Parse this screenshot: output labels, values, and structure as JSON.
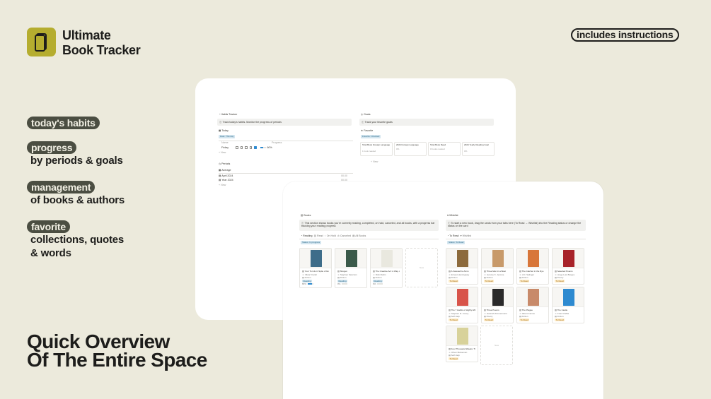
{
  "brand": {
    "title_line1": "Ultimate",
    "title_line2": "Book Tracker",
    "instructions_badge": "includes instructions"
  },
  "features": [
    {
      "pill": "today's habits",
      "sub1": "",
      "sub2": ""
    },
    {
      "pill": "progress",
      "sub1": "by periods & goals",
      "sub2": ""
    },
    {
      "pill": "management",
      "sub1": "of books & authors",
      "sub2": ""
    },
    {
      "pill": "favorite",
      "sub1": "collections, quotes",
      "sub2": "& words"
    }
  ],
  "headline": {
    "line1": "Quick Overview",
    "line2": "Of The Entire Space"
  },
  "back_screen": {
    "habits": {
      "title": "Habits Tracker",
      "callout": "Track today's habits. Monitor the progress of periods",
      "today_label": "Today",
      "today_chip": "Date: This day",
      "col_name": "Name",
      "col_progress": "Progress",
      "row_name": "Friday",
      "row_progress": "60%",
      "new": "New"
    },
    "periods": {
      "title": "Periods",
      "view": "Average",
      "rows": [
        {
          "name": "April 2024",
          "value": "00.00"
        },
        {
          "name": "Year 2024",
          "value": "00.00"
        }
      ],
      "new": "New"
    },
    "goals": {
      "title": "Goals",
      "callout": "Track your favorite goals",
      "fav_label": "Favorite",
      "fav_chip": "Favorite: Checked",
      "cards": [
        {
          "title": "Total Book Foreign Language",
          "sub": "1 book readed"
        },
        {
          "title": "2024 Foreign Language",
          "sub": "0%"
        },
        {
          "title": "Total Book Read",
          "sub": "0 books readed"
        },
        {
          "title": "2024 Yearly Reading Goal",
          "sub": "0%"
        }
      ],
      "new": "New"
    }
  },
  "front_screen": {
    "books": {
      "title": "Books",
      "callout": "This section shows books you're currently reading, completed, on hold, canceled, and all books, with a progress bar tracking your reading progress",
      "tabs": [
        "Reading",
        "Read",
        "On Hold",
        "Canceled",
        "All Books"
      ],
      "filter": "Status: In progress",
      "new": "New",
      "cards": [
        {
          "title": "Your To Life in Spite of Everything",
          "author": "Viktor Frankl",
          "type": "Fiction",
          "status": "Reading",
          "progress": "80%",
          "fill": 0.8,
          "cover": "#3e6d8a"
        },
        {
          "title": "Shogun",
          "author": "Stephen Sanctum",
          "type": "Fiction",
          "status": "Reading",
          "progress": "0%",
          "fill": 0.0,
          "cover": "#3b5a4a"
        },
        {
          "title": "The Creative Act: A Way of Bein",
          "author": "Rick Rubin",
          "type": "Fiction",
          "status": "Reading",
          "progress": "0%",
          "fill": 0.0,
          "cover": "#e9e8df"
        }
      ]
    },
    "wishlist": {
      "title": "Wishlist",
      "callout": "To start a new book, drag the cards from your tabs here (To Read → Wishlist) into the Reading status or change the status on the card",
      "tabs": [
        "To Read",
        "Wishlist"
      ],
      "filter": "Status: To Read",
      "new": "New",
      "cards": [
        {
          "title": "A Farewell to Arms",
          "author": "Ernest Hemingway",
          "type": "Fiction",
          "status": "To Read",
          "cover": "#8c6a3c"
        },
        {
          "title": "Three Men in a Boat",
          "author": "Jerome K. Jerome",
          "type": "Fiction",
          "status": "To Read",
          "cover": "#c89a6a"
        },
        {
          "title": "The Catcher in the Rye",
          "author": "J.D. Salinger",
          "type": "Fiction",
          "status": "To Read",
          "cover": "#d8763a"
        },
        {
          "title": "Selected Poems",
          "author": "Jorge Luis Borges",
          "type": "Poetry",
          "status": "To Read",
          "cover": "#a8232a"
        },
        {
          "title": "The 7 Habits of Highly Effective People",
          "author": "Stephen R. Covey",
          "type": "Self Help",
          "status": "To Read",
          "cover": "#d8544a"
        },
        {
          "title": "Three Poems",
          "author": "Hannah Zimmermann",
          "type": "Poetry",
          "status": "To Read",
          "cover": "#2a2a2a"
        },
        {
          "title": "The Plague",
          "author": "Albert Camus",
          "type": "Fiction",
          "status": "To Read",
          "cover": "#c88a6a"
        },
        {
          "title": "The Castle",
          "author": "Franz Kafka",
          "type": "Fiction",
          "status": "To Read",
          "cover": "#2e8ad0"
        },
        {
          "title": "Four Thousand Weeks: Time Management for Mortals",
          "author": "Oliver Burkeman",
          "type": "Self Help",
          "status": "To Read",
          "cover": "#d8d29a"
        }
      ]
    }
  }
}
